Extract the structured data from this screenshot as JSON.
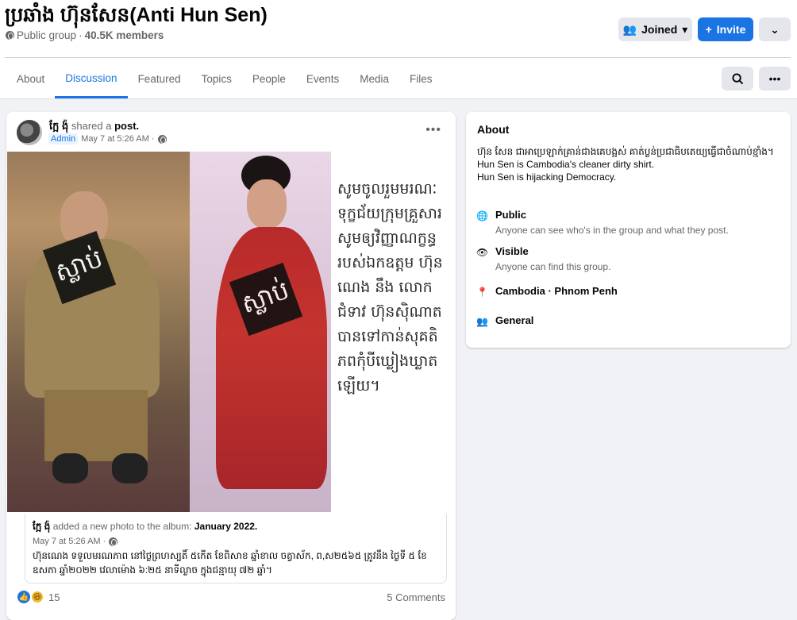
{
  "group": {
    "title": "ប្រឆាំង ហ៊ុនសែន(Anti Hun Sen)",
    "privacy": "Public group",
    "members": "40.5K members"
  },
  "actions": {
    "joined_label": "Joined",
    "invite_label": "Invite"
  },
  "tabs": [
    "About",
    "Discussion",
    "Featured",
    "Topics",
    "People",
    "Events",
    "Media",
    "Files"
  ],
  "post": {
    "author": "ក្អែ ង៉ុ",
    "shared_text": "shared a",
    "post_link": "post.",
    "badge": "Admin",
    "time": "May 7 at 5:26 AM ·",
    "photo_text": "សូមចូលរួមមរណៈ ទុក្ខជ័យក្រុមគ្រួសារ សូមឲ្យវិញ្ញាណក្ខន្ធ របស់ឯកឧត្តម ហ៊ុន ណេង នឹង លោកជំទាវ ហ៊ុនសុិណាត បានទៅកាន់សុគតិ ភពកុំបីឃ្លៀងឃ្លាតឡើយ។",
    "stamp_text": "ស្លាប់",
    "shared_card": {
      "author": "ក្អែ ង៉ុ",
      "action_text": "added a new photo to the album:",
      "album": "January 2022.",
      "time": "May 7 at 5:26 AM ·",
      "text": "ហ៊ុនណេង ទទួលមរណភាព នៅថ្ងៃព្រហស្បតិ៍ ៥កើត ខែពិសាខ ឆ្នាំខាល ចត្វាស័ក, ព,ស២៥៦៥ ត្រូវនឹង ថ្ងៃទី ៥ ខែឧសភា ឆ្នាំ២០២២ វេលាម៉ោង ៦:២៥ នាទីល្ងាច ក្នុងជន្មាយុ ៧២ ឆ្នាំ។"
    },
    "reaction_count": "15",
    "comments": "5 Comments"
  },
  "about": {
    "heading": "About",
    "description_line1": "ហ៊ុន សែន ជាអាប្រេឡាក់គ្រាន់ជាងគេបង្អស់ គាត់ប្លន់ប្រជាធិបតេយ្យធ្វើជាចំណាប់ខ្មាំង។",
    "description_line2": "Hun Sen is Cambodia's cleaner dirty shirt.",
    "description_line3": "Hun Sen is hijacking Democracy.",
    "public_title": "Public",
    "public_sub": "Anyone can see who's in the group and what they post.",
    "visible_title": "Visible",
    "visible_sub": "Anyone can find this group.",
    "location": "Cambodia · Phnom Penh",
    "general": "General"
  },
  "icons": [
    "globe-icon",
    "people-icon",
    "caret-down-icon",
    "plus-icon",
    "chevron-down-icon",
    "search-icon",
    "more-icon",
    "eye-icon",
    "pin-icon"
  ],
  "colors": {
    "accent": "#1b74e4",
    "background": "#f0f2f5"
  }
}
